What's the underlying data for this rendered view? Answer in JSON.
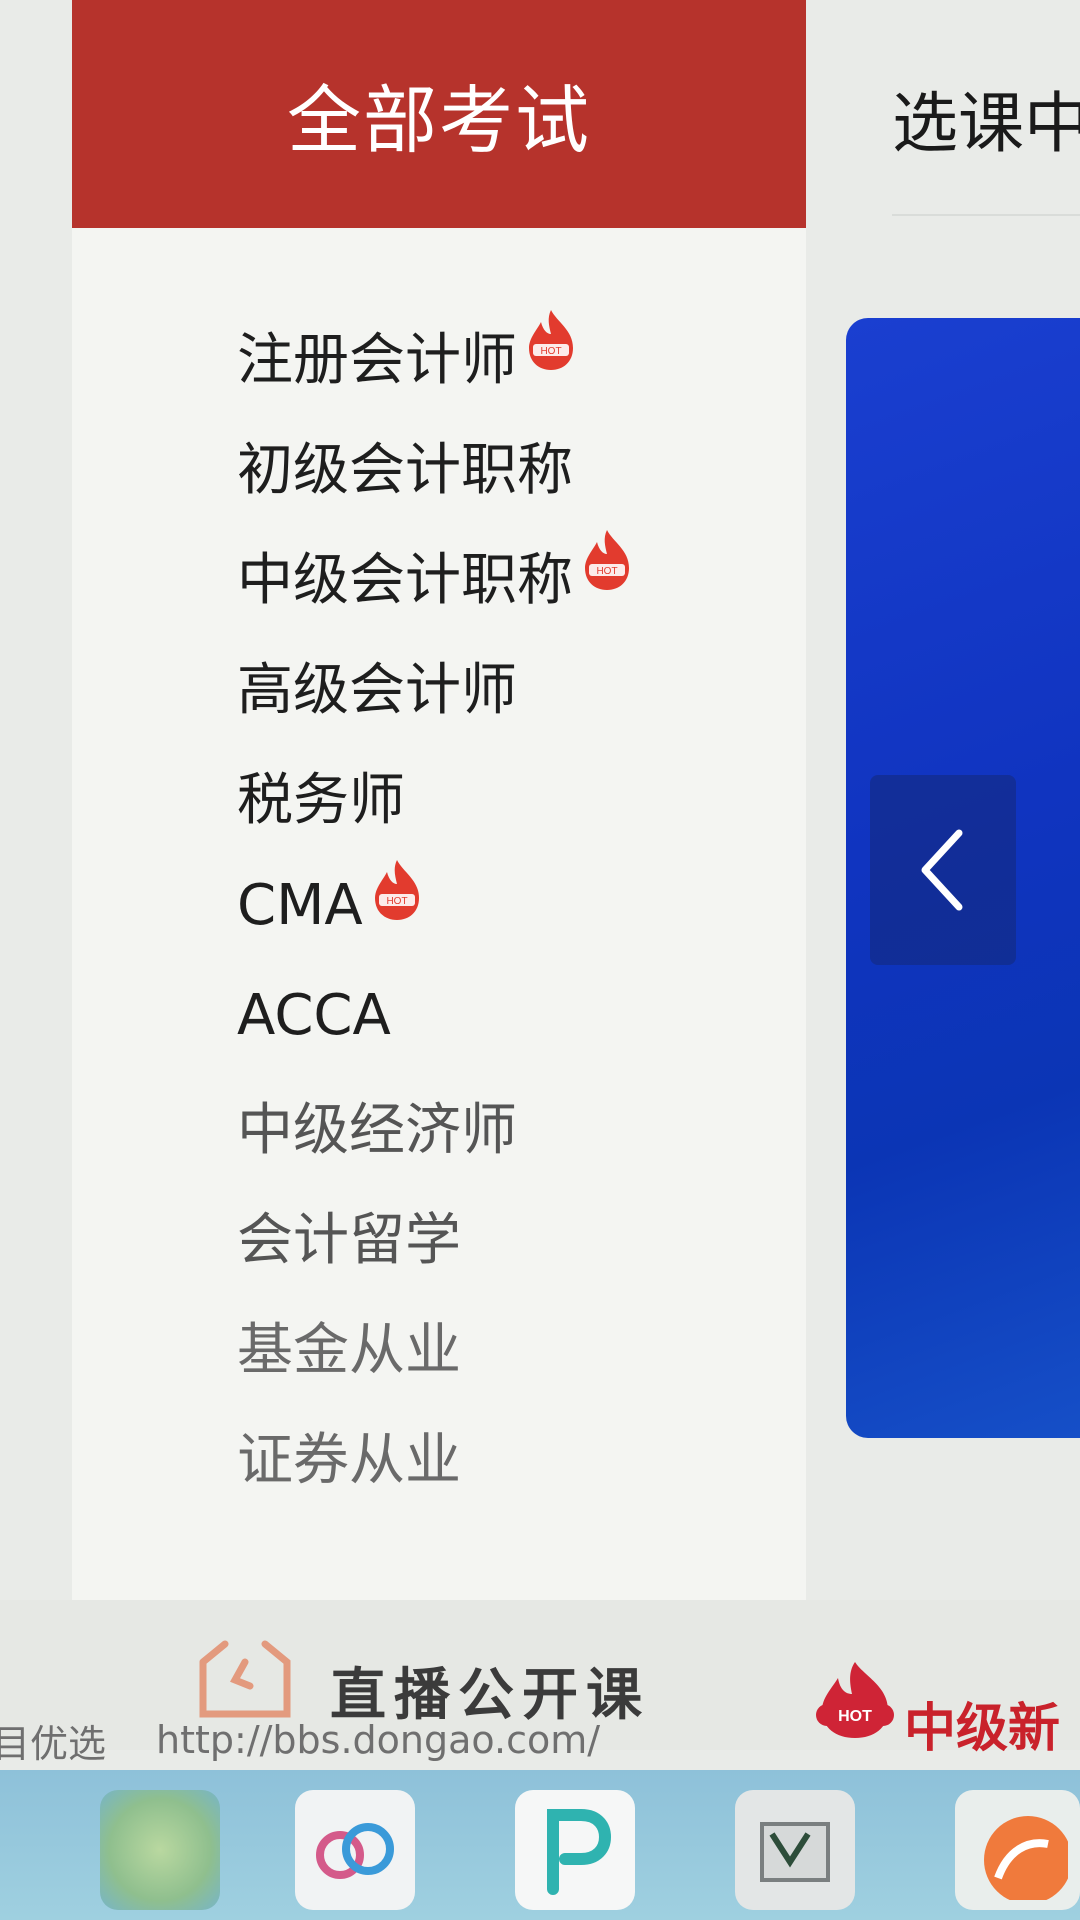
{
  "sidebar": {
    "header": "全部考试",
    "items": [
      {
        "label": "注册会计师",
        "hot": true
      },
      {
        "label": "初级会计职称",
        "hot": false
      },
      {
        "label": "中级会计职称",
        "hot": true
      },
      {
        "label": "高级会计师",
        "hot": false
      },
      {
        "label": "税务师",
        "hot": false
      },
      {
        "label": "CMA",
        "hot": true
      },
      {
        "label": "ACCA",
        "hot": false
      },
      {
        "label": "中级经济师",
        "hot": false
      },
      {
        "label": "会计留学",
        "hot": false
      },
      {
        "label": "基金从业",
        "hot": false
      },
      {
        "label": "证券从业",
        "hot": false
      }
    ]
  },
  "top_tab": {
    "label": "选课中"
  },
  "banner": {
    "prev_icon": "chevron-left-icon"
  },
  "promo": {
    "live_text": "直播公开课",
    "hot_text": "中级新"
  },
  "status_bar": {
    "prefix": "目优选",
    "url": "http://bbs.dongao.com/"
  },
  "colors": {
    "header_bg": "#b6332c",
    "banner_blue": "#1034c0",
    "hot_red": "#e23b2e"
  }
}
